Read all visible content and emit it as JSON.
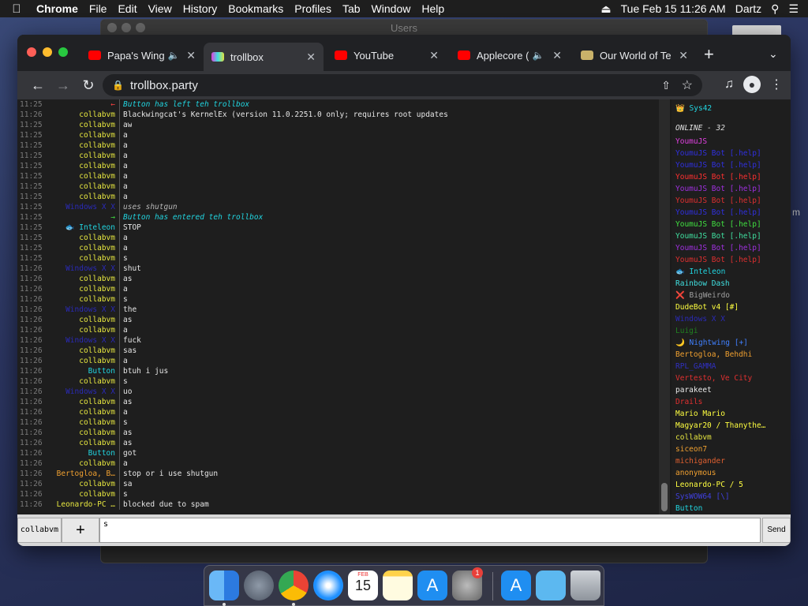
{
  "menubar": {
    "app": "Chrome",
    "items": [
      "File",
      "Edit",
      "View",
      "History",
      "Bookmarks",
      "Profiles",
      "Tab",
      "Window",
      "Help"
    ],
    "datetime": "Tue Feb 15  11:26 AM",
    "user": "Dartz"
  },
  "background_window": {
    "title": "Users"
  },
  "side_text": "m",
  "tabs": [
    {
      "title": "Papa's Wing",
      "icon": "youtube-icon",
      "audio": true
    },
    {
      "title": "trollbox",
      "icon": "trollbox-icon",
      "active": true
    },
    {
      "title": "YouTube",
      "icon": "youtube-icon"
    },
    {
      "title": "Applecore (",
      "icon": "youtube-icon",
      "audio": true
    },
    {
      "title": "Our World of Te",
      "icon": "page-icon"
    }
  ],
  "toolbar": {
    "url": "trollbox.party"
  },
  "chat": [
    {
      "time": "11:25",
      "nick": "←",
      "nick_color": "#ff4040",
      "msg": "Button has left teh trollbox",
      "sys": true,
      "msg_color": "#21d5e0"
    },
    {
      "time": "11:26",
      "nick": "collabvm",
      "nick_color": "#e8e840",
      "msg": "Blackwingcat's KernelEx (version 11.0.2251.0 only; requires root updates"
    },
    {
      "time": "11:25",
      "nick": "collabvm",
      "nick_color": "#e8e840",
      "msg": "aw"
    },
    {
      "time": "11:25",
      "nick": "collabvm",
      "nick_color": "#e8e840",
      "msg": "a"
    },
    {
      "time": "11:25",
      "nick": "collabvm",
      "nick_color": "#e8e840",
      "msg": "a"
    },
    {
      "time": "11:25",
      "nick": "collabvm",
      "nick_color": "#e8e840",
      "msg": "a"
    },
    {
      "time": "11:25",
      "nick": "collabvm",
      "nick_color": "#e8e840",
      "msg": "a"
    },
    {
      "time": "11:25",
      "nick": "collabvm",
      "nick_color": "#e8e840",
      "msg": "a"
    },
    {
      "time": "11:25",
      "nick": "collabvm",
      "nick_color": "#e8e840",
      "msg": "a"
    },
    {
      "time": "11:25",
      "nick": "collabvm",
      "nick_color": "#e8e840",
      "msg": "a"
    },
    {
      "time": "11:25",
      "nick": "Windows X X",
      "nick_color": "#2a2ab8",
      "msg": "uses shutgun",
      "sys": true
    },
    {
      "time": "11:25",
      "nick": "→",
      "nick_color": "#40e040",
      "msg": "Button has entered teh trollbox",
      "sys": true,
      "msg_color": "#21d5e0"
    },
    {
      "time": "11:25",
      "nick": "🐟 Inteleon",
      "nick_color": "#21d5e0",
      "msg": "STOP"
    },
    {
      "time": "11:25",
      "nick": "collabvm",
      "nick_color": "#e8e840",
      "msg": "a"
    },
    {
      "time": "11:25",
      "nick": "collabvm",
      "nick_color": "#e8e840",
      "msg": "a"
    },
    {
      "time": "11:25",
      "nick": "collabvm",
      "nick_color": "#e8e840",
      "msg": "s"
    },
    {
      "time": "11:26",
      "nick": "Windows X X",
      "nick_color": "#2a2ab8",
      "msg": "shut"
    },
    {
      "time": "11:26",
      "nick": "collabvm",
      "nick_color": "#e8e840",
      "msg": "as"
    },
    {
      "time": "11:26",
      "nick": "collabvm",
      "nick_color": "#e8e840",
      "msg": "a"
    },
    {
      "time": "11:26",
      "nick": "collabvm",
      "nick_color": "#e8e840",
      "msg": "s"
    },
    {
      "time": "11:26",
      "nick": "Windows X X",
      "nick_color": "#2a2ab8",
      "msg": "the"
    },
    {
      "time": "11:26",
      "nick": "collabvm",
      "nick_color": "#e8e840",
      "msg": "as"
    },
    {
      "time": "11:26",
      "nick": "collabvm",
      "nick_color": "#e8e840",
      "msg": "a"
    },
    {
      "time": "11:26",
      "nick": "Windows X X",
      "nick_color": "#2a2ab8",
      "msg": "fuck"
    },
    {
      "time": "11:26",
      "nick": "collabvm",
      "nick_color": "#e8e840",
      "msg": "sas"
    },
    {
      "time": "11:26",
      "nick": "collabvm",
      "nick_color": "#e8e840",
      "msg": "a"
    },
    {
      "time": "11:26",
      "nick": "Button",
      "nick_color": "#21d5e0",
      "msg": "btuh i jus"
    },
    {
      "time": "11:26",
      "nick": "collabvm",
      "nick_color": "#e8e840",
      "msg": "s"
    },
    {
      "time": "11:26",
      "nick": "Windows X X",
      "nick_color": "#2a2ab8",
      "msg": "uo"
    },
    {
      "time": "11:26",
      "nick": "collabvm",
      "nick_color": "#e8e840",
      "msg": "as"
    },
    {
      "time": "11:26",
      "nick": "collabvm",
      "nick_color": "#e8e840",
      "msg": "a"
    },
    {
      "time": "11:26",
      "nick": "collabvm",
      "nick_color": "#e8e840",
      "msg": "s"
    },
    {
      "time": "11:26",
      "nick": "collabvm",
      "nick_color": "#e8e840",
      "msg": "as"
    },
    {
      "time": "11:26",
      "nick": "collabvm",
      "nick_color": "#e8e840",
      "msg": "as"
    },
    {
      "time": "11:26",
      "nick": "Button",
      "nick_color": "#21d5e0",
      "msg": "got"
    },
    {
      "time": "11:26",
      "nick": "collabvm",
      "nick_color": "#e8e840",
      "msg": "a"
    },
    {
      "time": "11:26",
      "nick": "Bertogloa, B…",
      "nick_color": "#f0a030",
      "msg": "stop or i use shutgun"
    },
    {
      "time": "11:26",
      "nick": "collabvm",
      "nick_color": "#e8e840",
      "msg": "sa"
    },
    {
      "time": "11:26",
      "nick": "collabvm",
      "nick_color": "#e8e840",
      "msg": "s"
    },
    {
      "time": "11:26",
      "nick": "Leonardo-PC …",
      "nick_color": "#e8e840",
      "msg": "blocked due to spam"
    }
  ],
  "users_panel": {
    "me": "👑 Sys42",
    "online_label": "ONLINE - 32",
    "users": [
      {
        "name": "YoumuJS",
        "color": "#e040e0"
      },
      {
        "name": "YoumuJS Bot [.help]",
        "color": "#3030e0"
      },
      {
        "name": "YoumuJS Bot [.help]",
        "color": "#3030e0"
      },
      {
        "name": "YoumuJS Bot [.help]",
        "color": "#ff3030"
      },
      {
        "name": "YoumuJS Bot [.help]",
        "color": "#a030e0"
      },
      {
        "name": "YoumuJS Bot [.help]",
        "color": "#e03030"
      },
      {
        "name": "YoumuJS Bot [.help]",
        "color": "#3030e0"
      },
      {
        "name": "YoumuJS Bot [.help]",
        "color": "#40e040"
      },
      {
        "name": "YoumuJS Bot [.help]",
        "color": "#40e0a0"
      },
      {
        "name": "YoumuJS Bot [.help]",
        "color": "#a030e0"
      },
      {
        "name": "YoumuJS Bot [.help]",
        "color": "#e03030"
      },
      {
        "name": "🐟 Inteleon",
        "color": "#21d5e0"
      },
      {
        "name": "Rainbow Dash",
        "color": "#40e0e0"
      },
      {
        "name": "❌ BigWeirdo",
        "color": "#a0a0a0"
      },
      {
        "name": "DudeBot v4 [#]",
        "color": "#ffff40"
      },
      {
        "name": "Windows X X",
        "color": "#2a2ab8"
      },
      {
        "name": "Luigi",
        "color": "#208020"
      },
      {
        "name": "🌙 Nightwing [+]",
        "color": "#4080ff"
      },
      {
        "name": "Bertogloa, Behdhi",
        "color": "#f0a030"
      },
      {
        "name": "RPL_GAMMA",
        "color": "#3030c0"
      },
      {
        "name": "Vertesto, Ve City",
        "color": "#e03030"
      },
      {
        "name": "parakeet",
        "color": "#e8e8e8"
      },
      {
        "name": "Drails",
        "color": "#e03030"
      },
      {
        "name": "Mario Mario",
        "color": "#ffff40"
      },
      {
        "name": "Magyar20 / Thanythe…",
        "color": "#ffff40"
      },
      {
        "name": "collabvm",
        "color": "#e8e840"
      },
      {
        "name": "siceon7",
        "color": "#f0a030"
      },
      {
        "name": "michigander",
        "color": "#e06030"
      },
      {
        "name": "anonymous",
        "color": "#f0a030"
      },
      {
        "name": "Leonardo-PC / 5",
        "color": "#ffff40"
      },
      {
        "name": "SysWOW64 [\\]",
        "color": "#4040e0"
      },
      {
        "name": "Button",
        "color": "#21d5e0"
      }
    ]
  },
  "input": {
    "nick": "collabvm",
    "plus": "+",
    "value": "s",
    "send": "Send"
  },
  "dock": {
    "apps": [
      "finder-icon",
      "launchpad-icon",
      "chrome-icon",
      "safari-icon",
      "calendar-icon",
      "notes-icon",
      "app-store-icon",
      "system-preferences-icon",
      "app-store-icon",
      "downloads-folder-icon",
      "trash-icon"
    ],
    "calendar_month": "FEB",
    "calendar_day": "15",
    "badge": "1"
  }
}
